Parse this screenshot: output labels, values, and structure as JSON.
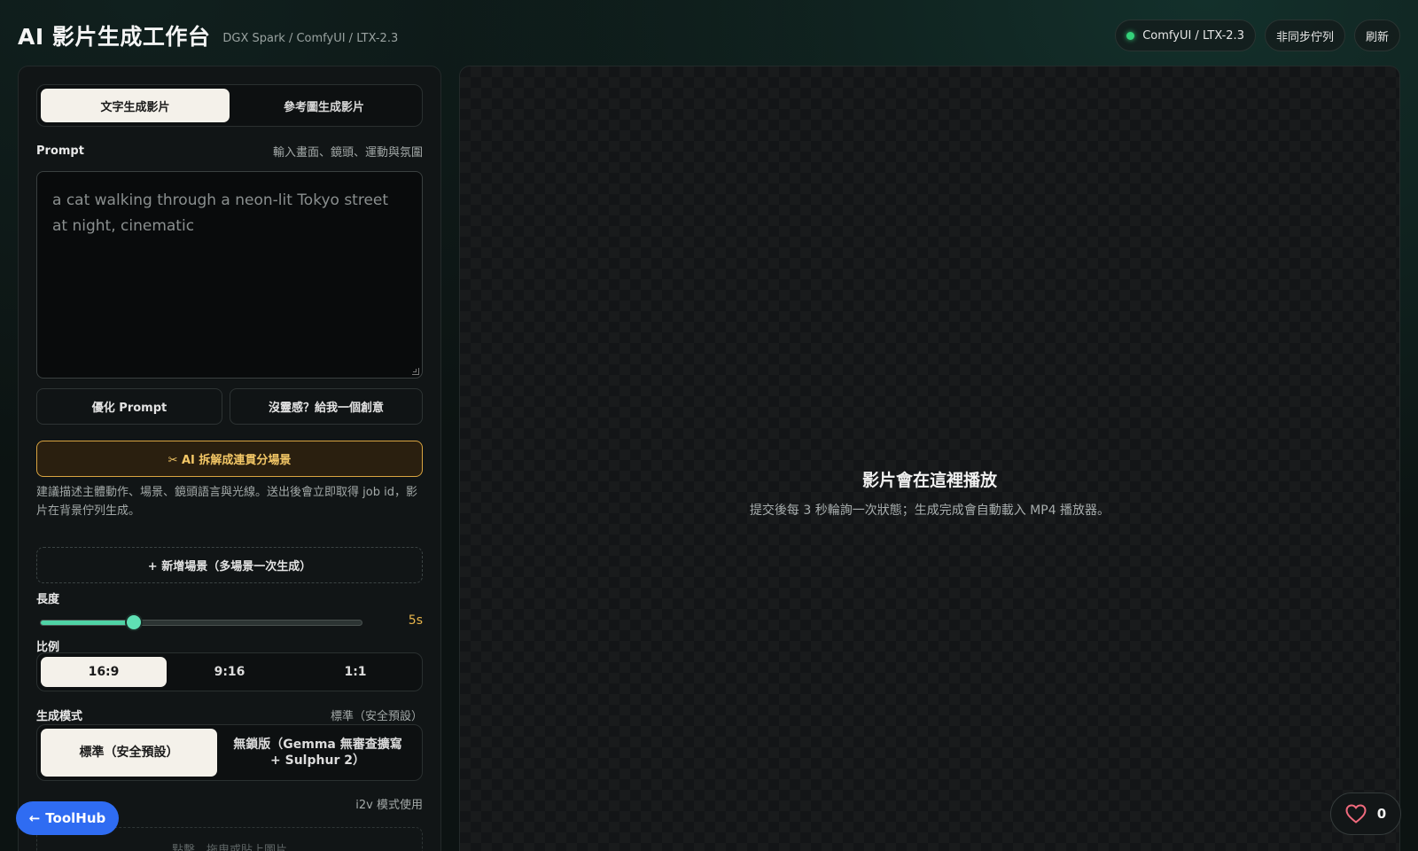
{
  "header": {
    "title": "AI 影片生成工作台",
    "subtitle": "DGX Spark / ComfyUI / LTX-2.3",
    "status_label": "ComfyUI / LTX-2.3",
    "queue_label": "非同步佇列",
    "refresh_label": "刷新"
  },
  "tabs": [
    {
      "label": "文字生成影片",
      "active": true
    },
    {
      "label": "參考圖生成影片",
      "active": false
    }
  ],
  "prompt": {
    "label": "Prompt",
    "hint": "輸入畫面、鏡頭、運動與氛圍",
    "placeholder": "a cat walking through a neon-lit Tokyo street at night, cinematic"
  },
  "actions": {
    "optimize_label": "優化 Prompt",
    "inspire_label": "沒靈感？給我一個創意",
    "split_label": "✂ AI 拆解成連貫分場景",
    "description": "建議描述主體動作、場景、鏡頭語言與光線。送出後會立即取得 job id，影片在背景佇列生成。",
    "add_scene_label": "+ 新增場景（多場景一次生成）"
  },
  "duration": {
    "label": "長度",
    "value_label": "5s",
    "fraction": 0.29
  },
  "ratio": {
    "label": "比例",
    "options": [
      {
        "label": "16:9",
        "active": true
      },
      {
        "label": "9:16",
        "active": false
      },
      {
        "label": "1:1",
        "active": false
      }
    ]
  },
  "mode": {
    "label": "生成模式",
    "current": "標準（安全預設）",
    "options": [
      {
        "label": "標準（安全預設）",
        "active": true
      },
      {
        "label": "無鎖版（Gemma 無審查擴寫 + Sulphur 2）",
        "active": false
      }
    ]
  },
  "reference": {
    "hint": "i2v 模式使用",
    "upload_label": "點擊、拖曳或貼上圖片"
  },
  "preview": {
    "title": "影片會在這裡播放",
    "description": "提交後每 3 秒輪詢一次狀態；生成完成會自動載入 MP4 播放器。"
  },
  "floating": {
    "toolhub_label": "ToolHub",
    "like_count": "0"
  },
  "colors": {
    "accent_green": "#4fd3a6",
    "accent_gold": "#e8b54b",
    "toolhub_blue": "#2f6cf2",
    "status_green": "#34d27a"
  }
}
